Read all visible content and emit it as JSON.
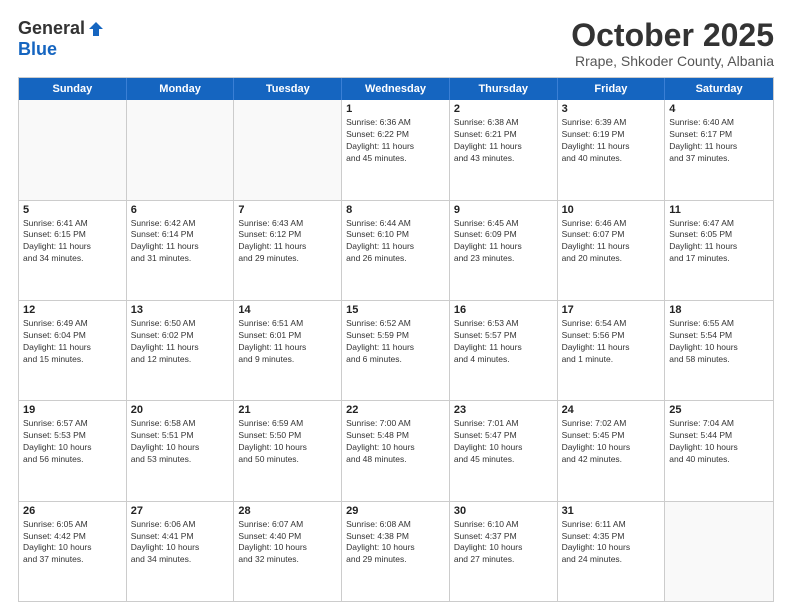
{
  "logo": {
    "general": "General",
    "blue": "Blue"
  },
  "title": {
    "month": "October 2025",
    "location": "Rrape, Shkoder County, Albania"
  },
  "weekdays": [
    "Sunday",
    "Monday",
    "Tuesday",
    "Wednesday",
    "Thursday",
    "Friday",
    "Saturday"
  ],
  "rows": [
    [
      {
        "day": "",
        "content": ""
      },
      {
        "day": "",
        "content": ""
      },
      {
        "day": "",
        "content": ""
      },
      {
        "day": "1",
        "content": "Sunrise: 6:36 AM\nSunset: 6:22 PM\nDaylight: 11 hours\nand 45 minutes."
      },
      {
        "day": "2",
        "content": "Sunrise: 6:38 AM\nSunset: 6:21 PM\nDaylight: 11 hours\nand 43 minutes."
      },
      {
        "day": "3",
        "content": "Sunrise: 6:39 AM\nSunset: 6:19 PM\nDaylight: 11 hours\nand 40 minutes."
      },
      {
        "day": "4",
        "content": "Sunrise: 6:40 AM\nSunset: 6:17 PM\nDaylight: 11 hours\nand 37 minutes."
      }
    ],
    [
      {
        "day": "5",
        "content": "Sunrise: 6:41 AM\nSunset: 6:15 PM\nDaylight: 11 hours\nand 34 minutes."
      },
      {
        "day": "6",
        "content": "Sunrise: 6:42 AM\nSunset: 6:14 PM\nDaylight: 11 hours\nand 31 minutes."
      },
      {
        "day": "7",
        "content": "Sunrise: 6:43 AM\nSunset: 6:12 PM\nDaylight: 11 hours\nand 29 minutes."
      },
      {
        "day": "8",
        "content": "Sunrise: 6:44 AM\nSunset: 6:10 PM\nDaylight: 11 hours\nand 26 minutes."
      },
      {
        "day": "9",
        "content": "Sunrise: 6:45 AM\nSunset: 6:09 PM\nDaylight: 11 hours\nand 23 minutes."
      },
      {
        "day": "10",
        "content": "Sunrise: 6:46 AM\nSunset: 6:07 PM\nDaylight: 11 hours\nand 20 minutes."
      },
      {
        "day": "11",
        "content": "Sunrise: 6:47 AM\nSunset: 6:05 PM\nDaylight: 11 hours\nand 17 minutes."
      }
    ],
    [
      {
        "day": "12",
        "content": "Sunrise: 6:49 AM\nSunset: 6:04 PM\nDaylight: 11 hours\nand 15 minutes."
      },
      {
        "day": "13",
        "content": "Sunrise: 6:50 AM\nSunset: 6:02 PM\nDaylight: 11 hours\nand 12 minutes."
      },
      {
        "day": "14",
        "content": "Sunrise: 6:51 AM\nSunset: 6:01 PM\nDaylight: 11 hours\nand 9 minutes."
      },
      {
        "day": "15",
        "content": "Sunrise: 6:52 AM\nSunset: 5:59 PM\nDaylight: 11 hours\nand 6 minutes."
      },
      {
        "day": "16",
        "content": "Sunrise: 6:53 AM\nSunset: 5:57 PM\nDaylight: 11 hours\nand 4 minutes."
      },
      {
        "day": "17",
        "content": "Sunrise: 6:54 AM\nSunset: 5:56 PM\nDaylight: 11 hours\nand 1 minute."
      },
      {
        "day": "18",
        "content": "Sunrise: 6:55 AM\nSunset: 5:54 PM\nDaylight: 10 hours\nand 58 minutes."
      }
    ],
    [
      {
        "day": "19",
        "content": "Sunrise: 6:57 AM\nSunset: 5:53 PM\nDaylight: 10 hours\nand 56 minutes."
      },
      {
        "day": "20",
        "content": "Sunrise: 6:58 AM\nSunset: 5:51 PM\nDaylight: 10 hours\nand 53 minutes."
      },
      {
        "day": "21",
        "content": "Sunrise: 6:59 AM\nSunset: 5:50 PM\nDaylight: 10 hours\nand 50 minutes."
      },
      {
        "day": "22",
        "content": "Sunrise: 7:00 AM\nSunset: 5:48 PM\nDaylight: 10 hours\nand 48 minutes."
      },
      {
        "day": "23",
        "content": "Sunrise: 7:01 AM\nSunset: 5:47 PM\nDaylight: 10 hours\nand 45 minutes."
      },
      {
        "day": "24",
        "content": "Sunrise: 7:02 AM\nSunset: 5:45 PM\nDaylight: 10 hours\nand 42 minutes."
      },
      {
        "day": "25",
        "content": "Sunrise: 7:04 AM\nSunset: 5:44 PM\nDaylight: 10 hours\nand 40 minutes."
      }
    ],
    [
      {
        "day": "26",
        "content": "Sunrise: 6:05 AM\nSunset: 4:42 PM\nDaylight: 10 hours\nand 37 minutes."
      },
      {
        "day": "27",
        "content": "Sunrise: 6:06 AM\nSunset: 4:41 PM\nDaylight: 10 hours\nand 34 minutes."
      },
      {
        "day": "28",
        "content": "Sunrise: 6:07 AM\nSunset: 4:40 PM\nDaylight: 10 hours\nand 32 minutes."
      },
      {
        "day": "29",
        "content": "Sunrise: 6:08 AM\nSunset: 4:38 PM\nDaylight: 10 hours\nand 29 minutes."
      },
      {
        "day": "30",
        "content": "Sunrise: 6:10 AM\nSunset: 4:37 PM\nDaylight: 10 hours\nand 27 minutes."
      },
      {
        "day": "31",
        "content": "Sunrise: 6:11 AM\nSunset: 4:35 PM\nDaylight: 10 hours\nand 24 minutes."
      },
      {
        "day": "",
        "content": ""
      }
    ]
  ]
}
